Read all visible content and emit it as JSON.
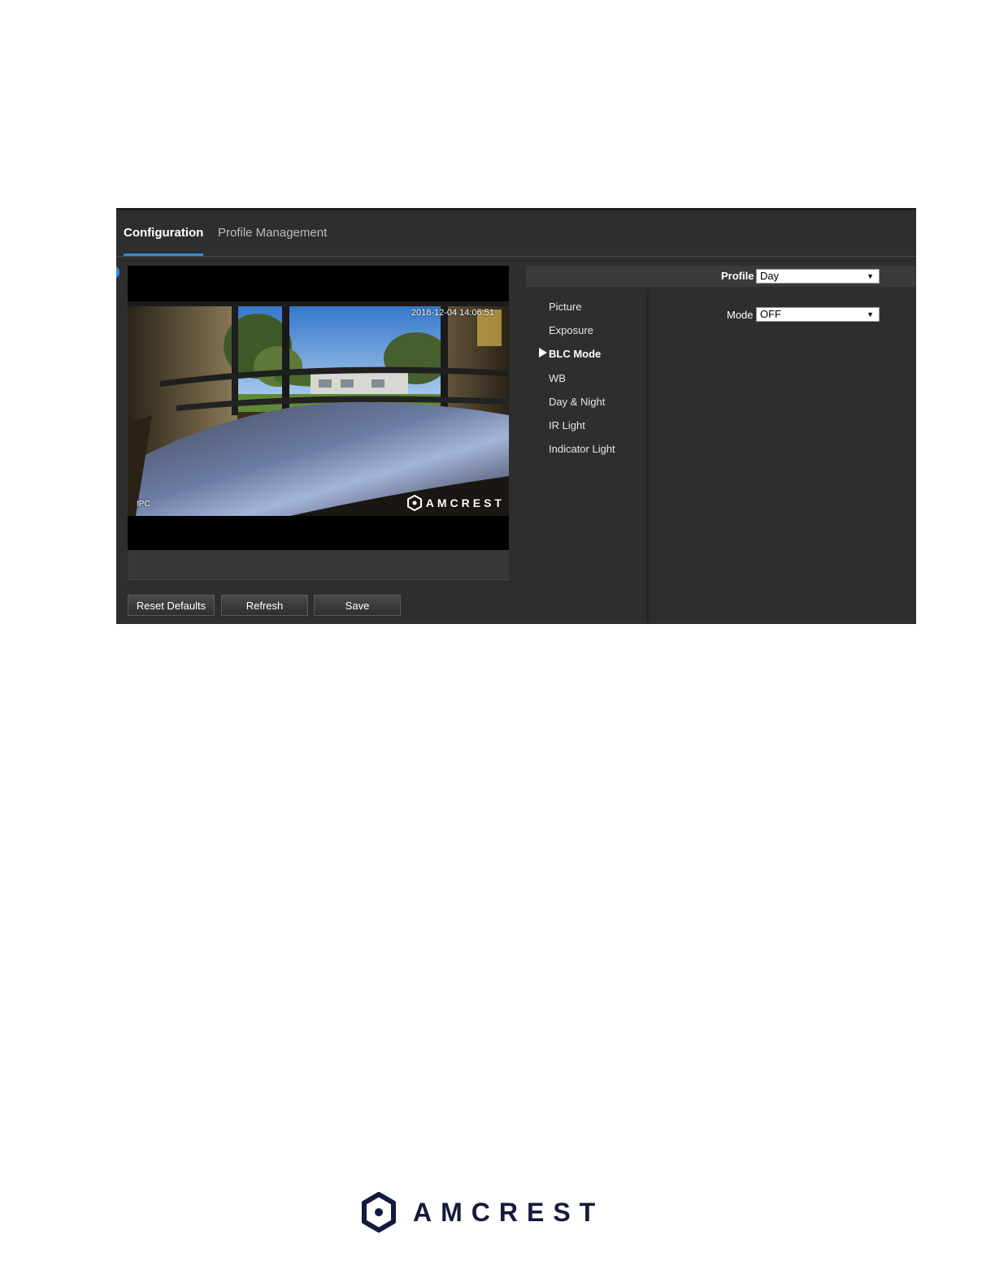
{
  "tabs": [
    {
      "label": "Configuration",
      "active": true
    },
    {
      "label": "Profile Management",
      "active": false
    }
  ],
  "preview": {
    "timestamp": "2018-12-04 14:06:51",
    "channel": "IPC",
    "watermark": "AMCREST"
  },
  "buttons": {
    "reset": "Reset Defaults",
    "refresh": "Refresh",
    "save": "Save"
  },
  "profile": {
    "label": "Profile",
    "value": "Day"
  },
  "menu": {
    "items": [
      {
        "label": "Picture"
      },
      {
        "label": "Exposure"
      },
      {
        "label": "BLC Mode",
        "active": true
      },
      {
        "label": "WB"
      },
      {
        "label": "Day & Night"
      },
      {
        "label": "IR Light"
      },
      {
        "label": "Indicator Light"
      }
    ]
  },
  "mode": {
    "label": "Mode",
    "value": "OFF"
  },
  "footer": {
    "brand": "AMCREST"
  },
  "colors": {
    "accent": "#2d8fe0",
    "panel": "#2e2e2e",
    "brand": "#141a3c"
  },
  "icons": {
    "dropdown": "chevron-down-icon",
    "menu_pointer": "triangle-right-icon",
    "logo": "amcrest-hexagon-icon"
  }
}
